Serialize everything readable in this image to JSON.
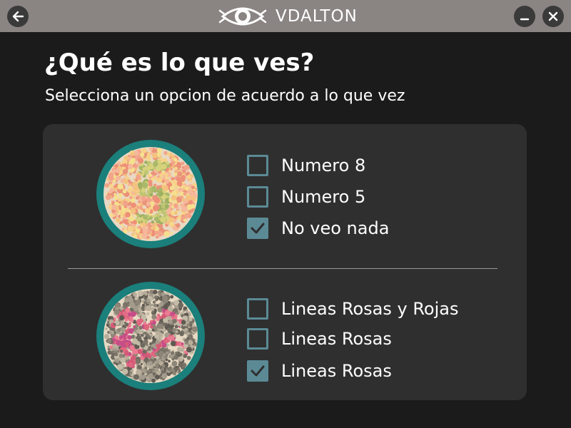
{
  "app": {
    "title": "VDALTON",
    "icons": {
      "back": "back-arrow-icon",
      "minimize": "minimize-icon",
      "close": "close-icon",
      "logo": "eye-logo-icon"
    }
  },
  "question": {
    "title": "¿Qué es lo que ves?",
    "instruction": "Selecciona un opcion de acuerdo a lo que vez"
  },
  "tests": [
    {
      "plate_icon": "ishihara-plate-icon",
      "options": [
        {
          "label": "Numero 8",
          "checked": false
        },
        {
          "label": "Numero 5",
          "checked": false
        },
        {
          "label": "No veo nada",
          "checked": true
        }
      ]
    },
    {
      "plate_icon": "ishihara-plate-icon",
      "options": [
        {
          "label": "Lineas Rosas y Rojas",
          "checked": false
        },
        {
          "label": "Lineas Rosas",
          "checked": false
        },
        {
          "label": "Lineas Rosas",
          "checked": true
        }
      ]
    }
  ],
  "colors": {
    "titlebar": "#8a8483",
    "background": "#1b1b1b",
    "card": "#2f2f2f",
    "checkbox": "#5b8a95",
    "plate_ring": "#1b7f7b"
  }
}
